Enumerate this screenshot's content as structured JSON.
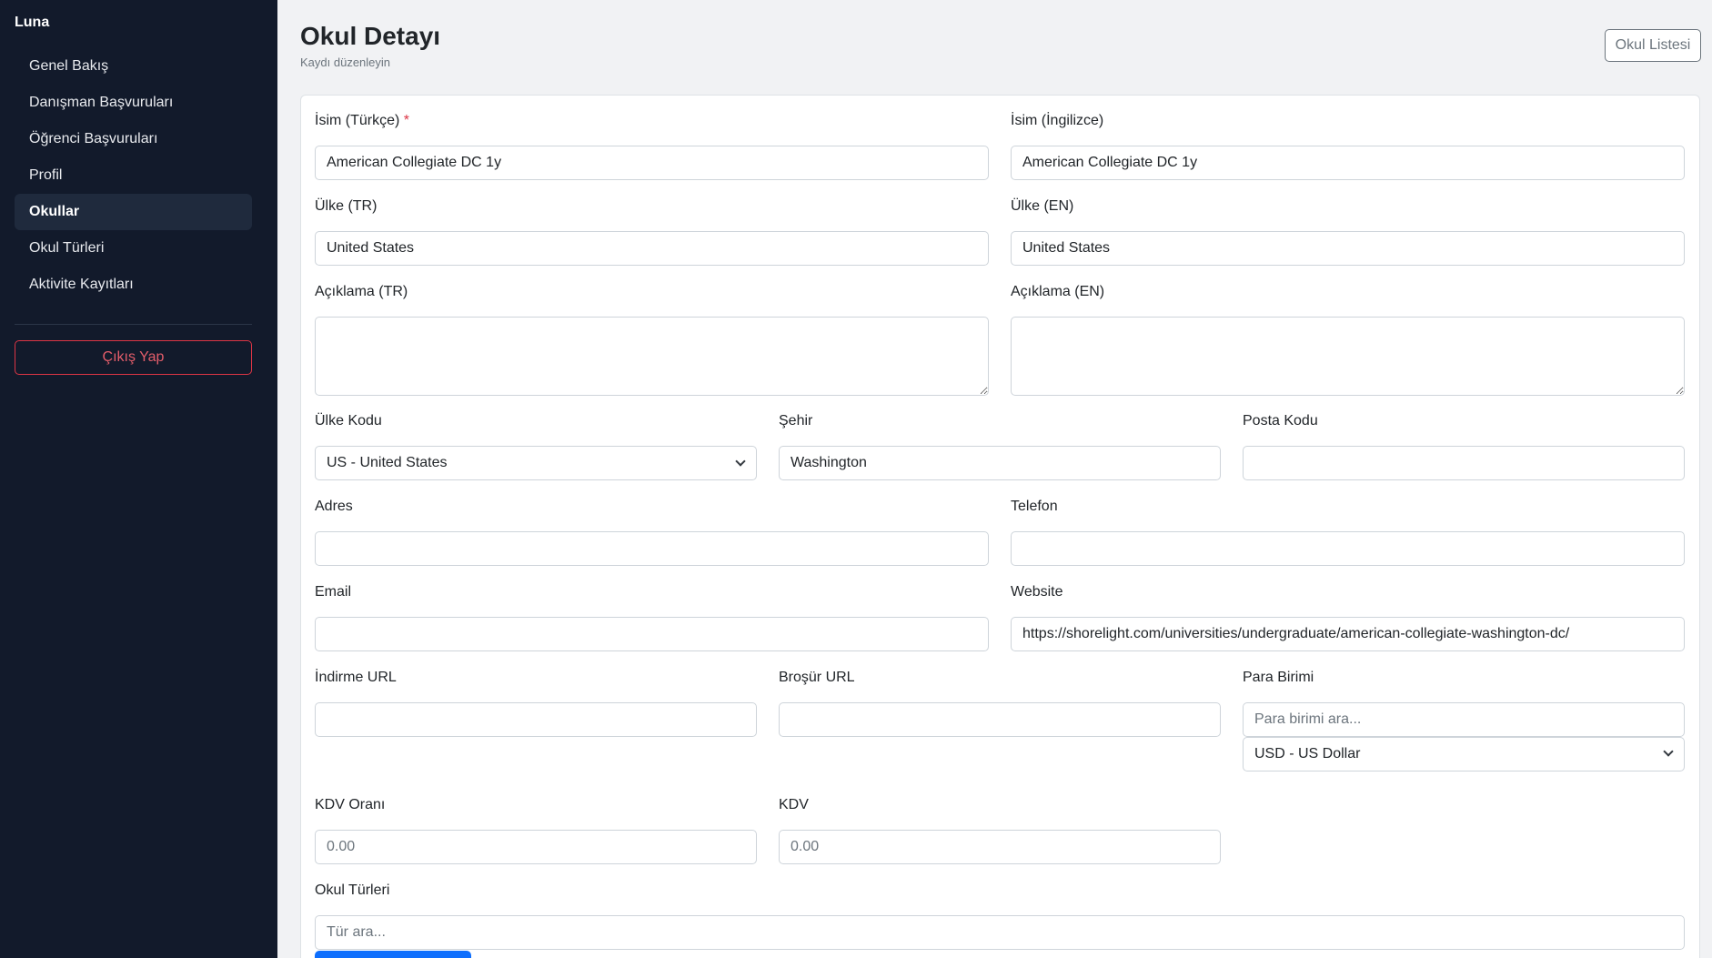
{
  "sidebar": {
    "brand": "Luna",
    "items": [
      {
        "label": "Genel Bakış"
      },
      {
        "label": "Danışman Başvuruları"
      },
      {
        "label": "Öğrenci Başvuruları"
      },
      {
        "label": "Profil"
      },
      {
        "label": "Okullar"
      },
      {
        "label": "Okul Türleri"
      },
      {
        "label": "Aktivite Kayıtları"
      }
    ],
    "active_item": "Okullar",
    "logout_label": "Çıkış Yap"
  },
  "header": {
    "title": "Okul Detayı",
    "subtitle": "Kaydı düzenleyin",
    "list_button": "Okul Listesi"
  },
  "form": {
    "name_tr": {
      "label": "İsim (Türkçe)",
      "required_mark": "*",
      "value": "American Collegiate DC 1y"
    },
    "name_en": {
      "label": "İsim (İngilizce)",
      "value": "American Collegiate DC 1y"
    },
    "country_tr": {
      "label": "Ülke (TR)",
      "value": "United States"
    },
    "country_en": {
      "label": "Ülke (EN)",
      "value": "United States"
    },
    "desc_tr": {
      "label": "Açıklama (TR)",
      "value": ""
    },
    "desc_en": {
      "label": "Açıklama (EN)",
      "value": ""
    },
    "country_code": {
      "label": "Ülke Kodu",
      "value": "US - United States"
    },
    "city": {
      "label": "Şehir",
      "value": "Washington"
    },
    "postal_code": {
      "label": "Posta Kodu",
      "value": ""
    },
    "address": {
      "label": "Adres",
      "value": ""
    },
    "phone": {
      "label": "Telefon",
      "value": ""
    },
    "email": {
      "label": "Email",
      "value": ""
    },
    "website": {
      "label": "Website",
      "value": "https://shorelight.com/universities/undergraduate/american-collegiate-washington-dc/"
    },
    "download_url": {
      "label": "İndirme URL",
      "value": ""
    },
    "brochure_url": {
      "label": "Broşür URL",
      "value": ""
    },
    "currency": {
      "label": "Para Birimi",
      "search_placeholder": "Para birimi ara...",
      "value": "USD - US Dollar"
    },
    "vat_rate": {
      "label": "KDV Oranı",
      "placeholder": "0.00"
    },
    "vat": {
      "label": "KDV",
      "placeholder": "0.00"
    },
    "school_types": {
      "label": "Okul Türleri",
      "search_placeholder": "Tür ara..."
    }
  }
}
